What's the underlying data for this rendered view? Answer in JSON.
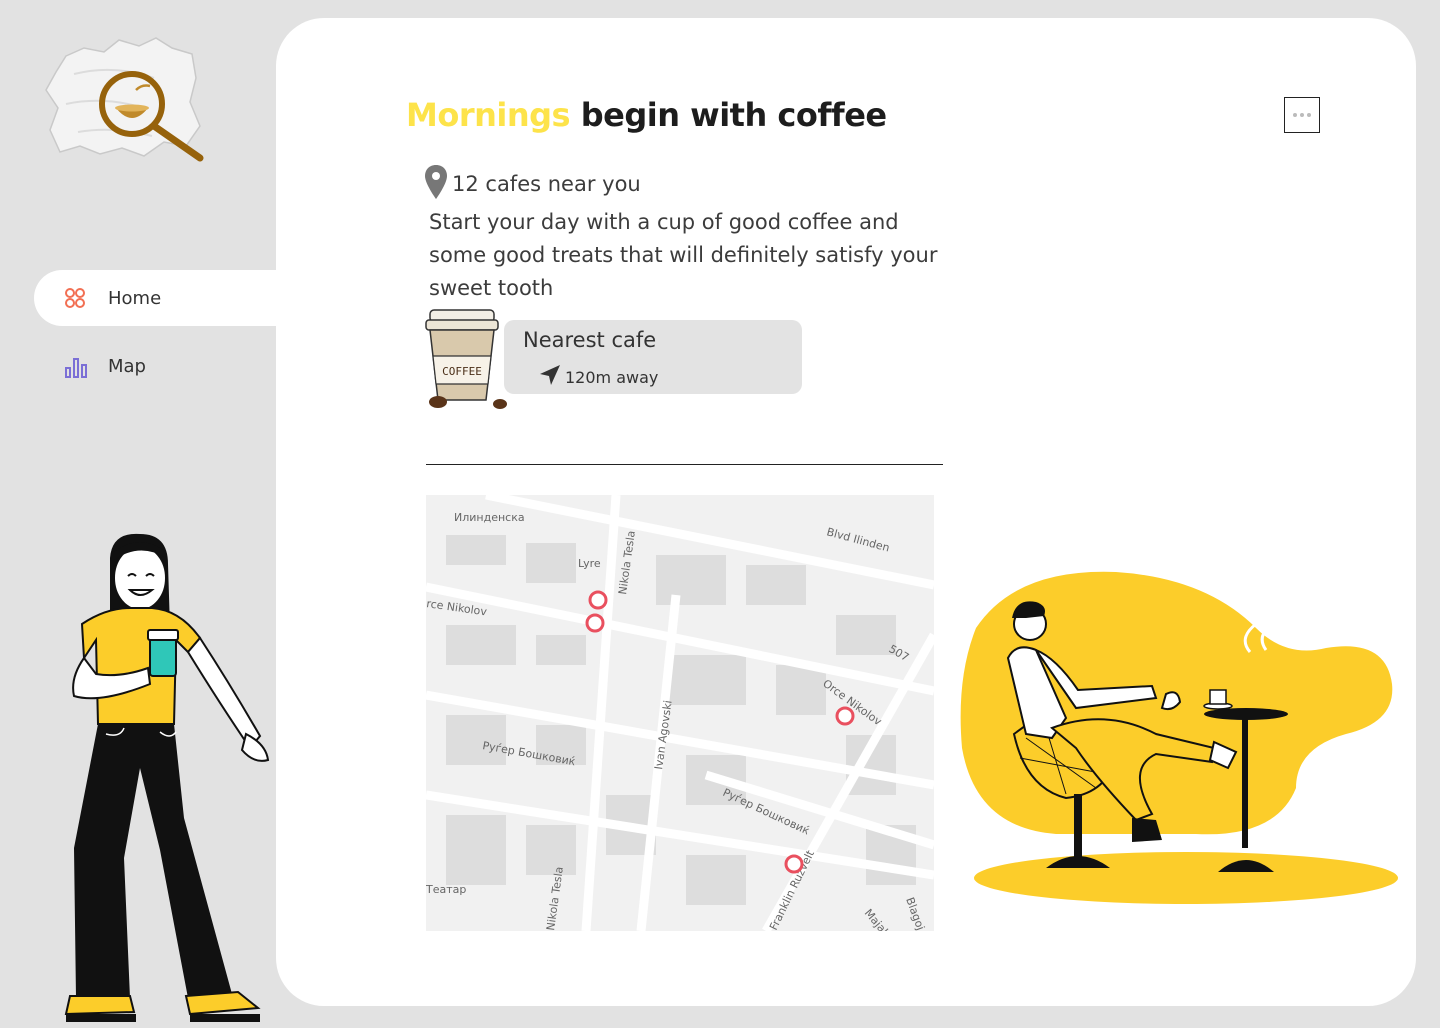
{
  "sidebar": {
    "items": [
      {
        "label": "Home",
        "icon": "grid-icon",
        "active": true
      },
      {
        "label": "Map",
        "icon": "bar-chart-icon",
        "active": false
      }
    ]
  },
  "main": {
    "headline_accent": "Mornings",
    "headline_rest": "begin with coffee",
    "nearby_text": "12 cafes near you",
    "description": "Start your day with a cup of good coffee and some good treats that will definitely satisfy your sweet tooth",
    "nearest_card": {
      "title": "Nearest cafe",
      "distance": "120m away",
      "cup_label": "COFFEE"
    },
    "map_labels": {
      "street_1": "Илинденска",
      "street_2": "Blvd Ilinden",
      "street_3": "Lyre",
      "street_4": "Nikola Tesla",
      "street_5": "rce Nikolov",
      "street_6": "507",
      "street_7": "Orce Nikolov",
      "street_8": "Ivan Agovski",
      "street_9": "Руѓер Бошковиќ",
      "street_10": "Руѓер Бошковиќ",
      "street_11": "Nikola Tesla",
      "street_12": "Franklin Ruzvelt",
      "street_13": "Театар",
      "street_14": "Majake",
      "street_15": "Blagoj"
    }
  },
  "colors": {
    "accent_yellow": "#fde34a",
    "illustration_yellow": "#fccd2a",
    "marker_red": "#e9505f",
    "background": "#e2e2e2"
  }
}
